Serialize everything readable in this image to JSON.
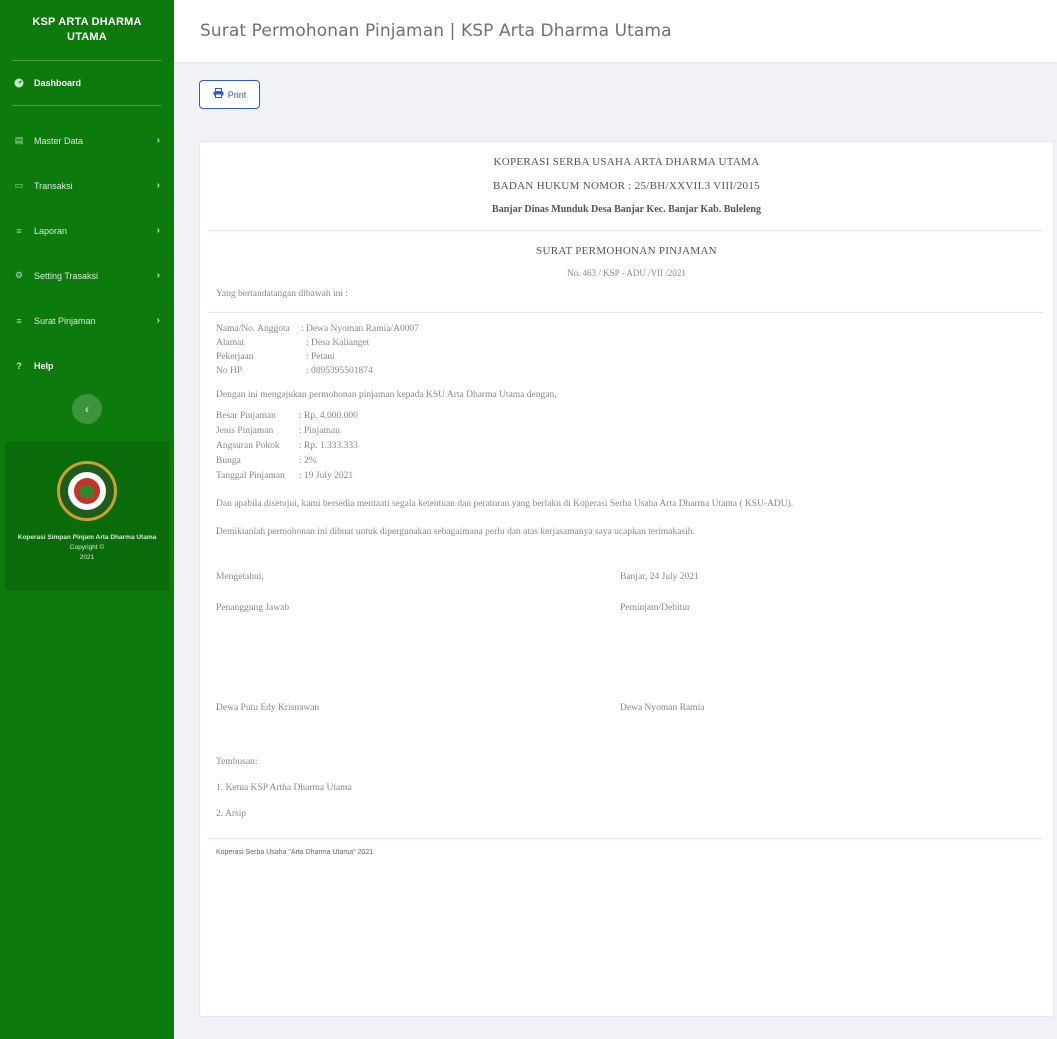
{
  "sidebar": {
    "brand": "KSP ARTA DHARMA UTAMA",
    "dashboard": "Dashboard",
    "items": [
      {
        "label": "Master Data",
        "icon": "table-icon"
      },
      {
        "label": "Transaksi",
        "icon": "card-icon"
      },
      {
        "label": "Laporan",
        "icon": "list-icon"
      },
      {
        "label": "Setting Trasaksi",
        "icon": "gear-icon"
      },
      {
        "label": "Surat Pinjaman",
        "icon": "list-icon"
      }
    ],
    "help": "Help",
    "promo": {
      "line1": "Koperasi Simpan Pinjam Arta Dharma Utama",
      "line2": "Copyright ©",
      "year": "2021"
    }
  },
  "topbar": {
    "title": "Surat Permohonan Pinjaman | KSP Arta Dharma Utama"
  },
  "toolbar": {
    "print_label": "Print"
  },
  "doc": {
    "org_name": "KOPERASI SERBA USAHA ARTA DHARMA UTAMA",
    "legal": "BADAN HUKUM NOMOR : 25/BH/XXVII.3 VIII/2015",
    "address": "Banjar Dinas Munduk Desa Banjar Kec. Banjar Kab. Buleleng",
    "letter_title": "SURAT PERMOHONAN PINJAMAN",
    "letter_no": "No. 463 / KSP - ADU /VII /2021",
    "intro": "Yang bertandatangan dibawah ini :",
    "applicant": [
      {
        "k": "Nama/No. Anggota",
        "v": ": Dewa Nyoman Ramia/A0007"
      },
      {
        "k": "Alamat",
        "v": ": Desa Kalianget"
      },
      {
        "k": "Pekerjaan",
        "v": ": Petani"
      },
      {
        "k": "No HP",
        "v": ": 0895395501874"
      }
    ],
    "request_line": "Dengan ini mengajukan permohonan pinjaman kepada KSU Arta Dharma Utama dengan,",
    "loan": [
      {
        "k": "Besar Pinjaman",
        "v": ": Rp. 4.000.000"
      },
      {
        "k": "Jenis Pinjaman",
        "v": ": Pinjaman"
      },
      {
        "k": "Angsuran Pokok",
        "v": ": Rp. 1.333.333"
      },
      {
        "k": "Bunga",
        "v": ": 2%"
      },
      {
        "k": "Tanggal Pinjaman",
        "v": ": 19 July 2021"
      }
    ],
    "agree": "Dan apabila disetujui, kami bersedia mentaati segala ketentuan dan peraturan yang berlaku di Koperasi Serba Usaha Arta Dharma Utama ( KSU-ADU).",
    "closing": "Demikianlah permohonan ini dibuat untuk dipergunakan sebagaimana perlu dan atas kerjasamanya saya ucapkan terimakasih.",
    "sign_left_label": "Mengetahui,",
    "sign_left_role": "Penanggung Jawab",
    "sign_left_name": "Dewa Putu Edy Krisnawan",
    "sign_right_place": "Banjar, 24 July 2021",
    "sign_right_role": "Peminjam/Debitur",
    "sign_right_name": "Dewa Nyoman Ramia",
    "cc_label": "Tembusan:",
    "cc": [
      "1. Ketua KSP Artha Dharma Utama",
      "2. Arsip"
    ],
    "footer": "Koperasi Serba Usaha \"Arta Dharma Utama\" 2021"
  },
  "colors": {
    "sidebar": "#0c7a0c",
    "accent": "#2e59d9"
  }
}
